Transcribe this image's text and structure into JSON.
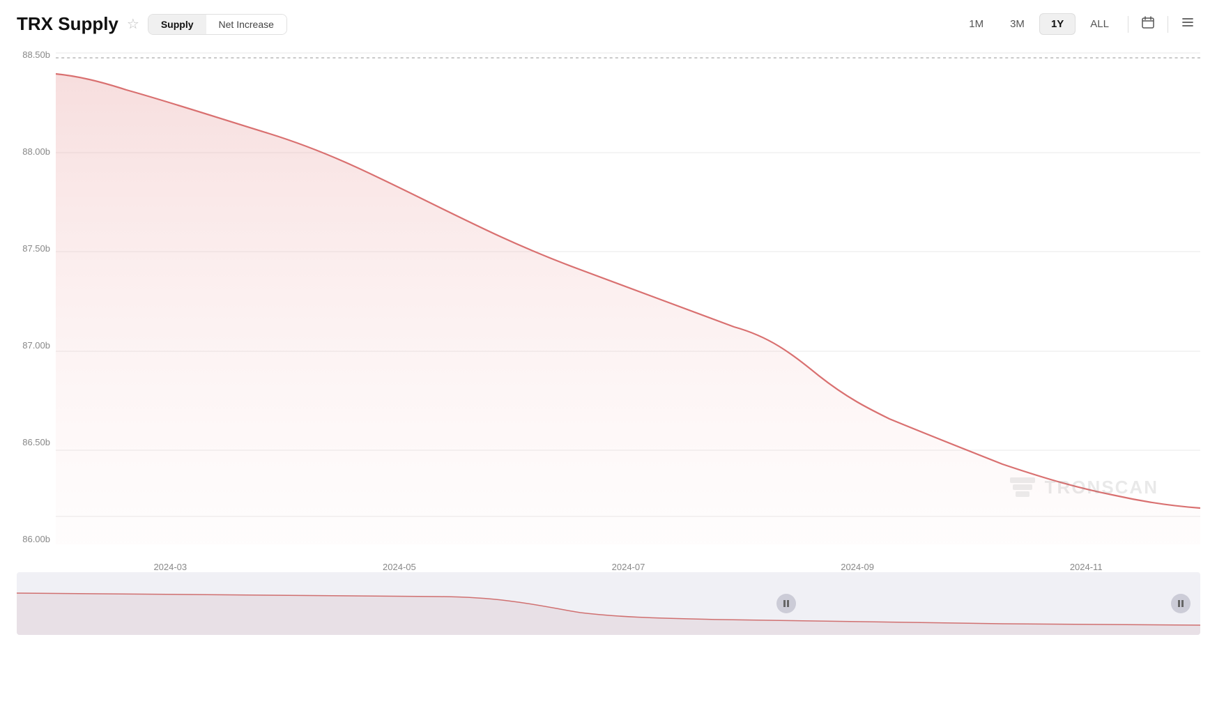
{
  "header": {
    "title": "TRX Supply",
    "star_label": "☆",
    "tabs": [
      {
        "label": "Supply",
        "active": true
      },
      {
        "label": "Net Increase",
        "active": false
      }
    ],
    "periods": [
      {
        "label": "1M",
        "active": false
      },
      {
        "label": "3M",
        "active": false
      },
      {
        "label": "1Y",
        "active": true
      },
      {
        "label": "ALL",
        "active": false
      }
    ],
    "icons": {
      "calendar": "🗓",
      "menu": "☰"
    }
  },
  "chart": {
    "y_labels": [
      "88.50b",
      "88.00b",
      "87.50b",
      "87.00b",
      "86.50b",
      "86.00b"
    ],
    "x_labels": [
      "2024-03",
      "2024-05",
      "2024-07",
      "2024-09",
      "2024-11"
    ],
    "watermark": "TRONSCAN"
  }
}
